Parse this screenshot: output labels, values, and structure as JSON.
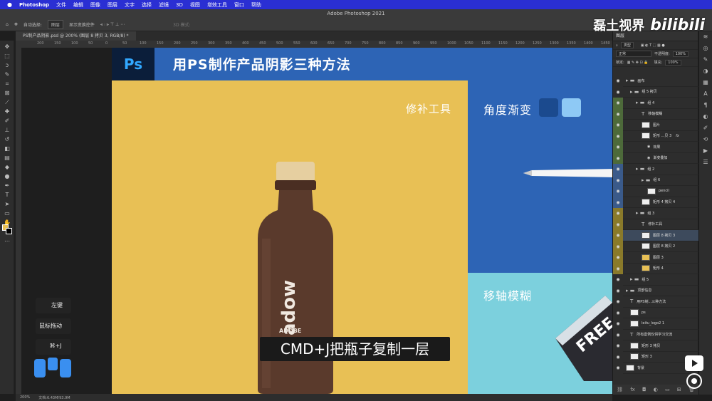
{
  "menubar": {
    "apple": "",
    "app": "Photoshop",
    "items": [
      "文件",
      "编辑",
      "图像",
      "图层",
      "文字",
      "选择",
      "滤镜",
      "3D",
      "视图",
      "增效工具",
      "窗口",
      "帮助"
    ]
  },
  "window_title": "Adobe Photoshop 2021",
  "options": {
    "auto_select": "自动选择:",
    "target": "图层",
    "show_transform": "显示变换控件",
    "mode_3d": "3D 模式:"
  },
  "watermark": {
    "channel": "磊土视界",
    "site": "bilibili"
  },
  "doc_tab": "PS制产品阴影.psd @ 200% (图层 8 拷贝 3, RGB/8) *",
  "ruler_ticks": [
    "200",
    "150",
    "100",
    "50",
    "0",
    "50",
    "100",
    "150",
    "200",
    "250",
    "300",
    "350",
    "400",
    "450",
    "500",
    "550",
    "600",
    "650",
    "700",
    "750",
    "800",
    "850",
    "900",
    "950",
    "1000",
    "1050",
    "1100",
    "1150",
    "1200",
    "1250",
    "1300",
    "1350",
    "1400",
    "1450",
    "1500"
  ],
  "slide": {
    "ps_logo": "Ps",
    "title": "用PS制作产品阴影三种方法",
    "label_patch": "修补工具",
    "label_gradient": "角度渐变",
    "label_tilt": "移轴模糊",
    "bottle_text": "shadow",
    "bottle_brand": "ADOBE",
    "box_text": "FREE",
    "colors": {
      "header": "#2d64b5",
      "yellow": "#e8c055",
      "blue": "#2d64b5",
      "cyan": "#7cd0dd",
      "swatch_dark": "#1b4a8e",
      "swatch_light": "#8ec9f5"
    }
  },
  "caption": "CMD+J把瓶子复制一层",
  "hints": {
    "left_click": "左键",
    "drag": "鼠标拖动",
    "shortcut": "⌘+J"
  },
  "status": {
    "zoom": "200%",
    "doc": "文档:6.43M/93.9M"
  },
  "layers_panel": {
    "title": "图层",
    "filter": "类型",
    "blend": "正常",
    "opacity_label": "不透明度:",
    "opacity": "100%",
    "lock_label": "锁定:",
    "fill_label": "填充:",
    "fill": "100%",
    "layers": [
      {
        "name": "画布",
        "kind": "folder"
      },
      {
        "name": "组 5 拷贝",
        "kind": "folder"
      },
      {
        "name": "组 4",
        "kind": "folder"
      },
      {
        "name": "移轴模糊",
        "kind": "text"
      },
      {
        "name": "图片",
        "kind": "image"
      },
      {
        "name": "矩形 ...贝 3",
        "kind": "image",
        "fx": "fx"
      },
      {
        "name": "效果",
        "kind": "effect"
      },
      {
        "name": "渐变叠加",
        "kind": "effect"
      },
      {
        "name": "组 2",
        "kind": "folder"
      },
      {
        "name": "组 6",
        "kind": "folder"
      },
      {
        "name": "pencil",
        "kind": "image"
      },
      {
        "name": "矩形 4 拷贝 4",
        "kind": "image"
      },
      {
        "name": "组 3",
        "kind": "folder"
      },
      {
        "name": "修补工具",
        "kind": "text"
      },
      {
        "name": "图层 8 拷贝 3",
        "kind": "image",
        "selected": true
      },
      {
        "name": "图层 8 拷贝 2",
        "kind": "image"
      },
      {
        "name": "图层 3",
        "kind": "image"
      },
      {
        "name": "矩形 4",
        "kind": "image"
      },
      {
        "name": "组 5",
        "kind": "folder"
      },
      {
        "name": "顶部信息",
        "kind": "folder"
      },
      {
        "name": "用PS制...三种方法",
        "kind": "text"
      },
      {
        "name": "ps",
        "kind": "image"
      },
      {
        "name": "leitu_logo2 1",
        "kind": "image"
      },
      {
        "name": "所有案例仅供学习交流",
        "kind": "text"
      },
      {
        "name": "矩形 3 拷贝",
        "kind": "image"
      },
      {
        "name": "矩形 3",
        "kind": "image"
      },
      {
        "name": "背景",
        "kind": "image"
      }
    ]
  }
}
